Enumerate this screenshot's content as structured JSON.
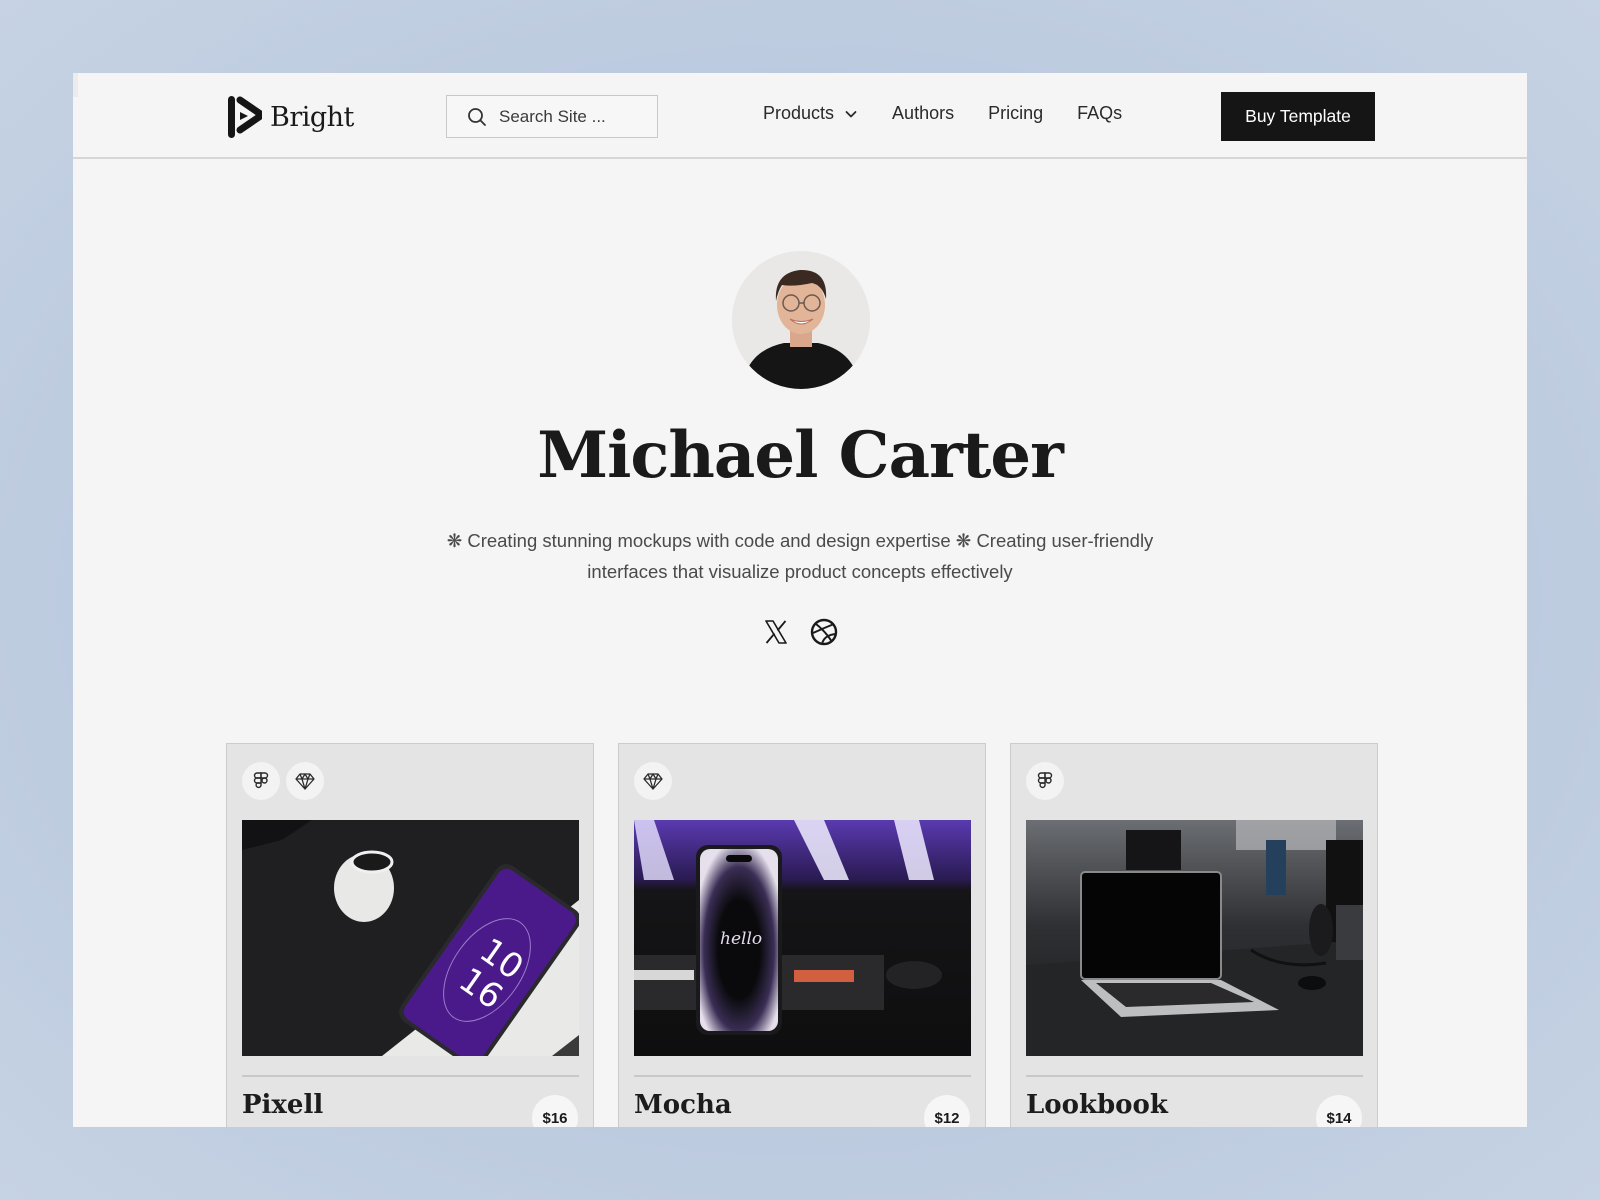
{
  "brand": {
    "name": "Bright"
  },
  "search": {
    "placeholder": "Search Site ..."
  },
  "nav": {
    "items": [
      {
        "label": "Products",
        "has_dropdown": true
      },
      {
        "label": "Authors"
      },
      {
        "label": "Pricing"
      },
      {
        "label": "FAQs"
      }
    ]
  },
  "header": {
    "cta_label": "Buy Template",
    "cta_color": "#151515"
  },
  "author": {
    "name": "Michael Carter",
    "bio": "❋ Creating stunning mockups with code and design expertise ❋ Creating user-friendly interfaces that visualize product concepts effectively",
    "socials": [
      {
        "icon": "x-twitter-icon"
      },
      {
        "icon": "dribbble-icon"
      }
    ]
  },
  "products": [
    {
      "title": "Pixell",
      "price": "$16",
      "tools": [
        "figma-icon",
        "sketch-icon"
      ],
      "image": "phone-with-earbuds-purple-clock"
    },
    {
      "title": "Mocha",
      "price": "$12",
      "tools": [
        "sketch-icon"
      ],
      "image": "iphone-hello-screen-keyboard"
    },
    {
      "title": "Lookbook",
      "price": "$14",
      "tools": [
        "figma-icon"
      ],
      "image": "laptop-on-office-desk"
    }
  ],
  "colors": {
    "background": "#f5f5f5",
    "card": "#e4e4e4",
    "text": "#1a1a1a",
    "page_backdrop": "#bccadf"
  }
}
